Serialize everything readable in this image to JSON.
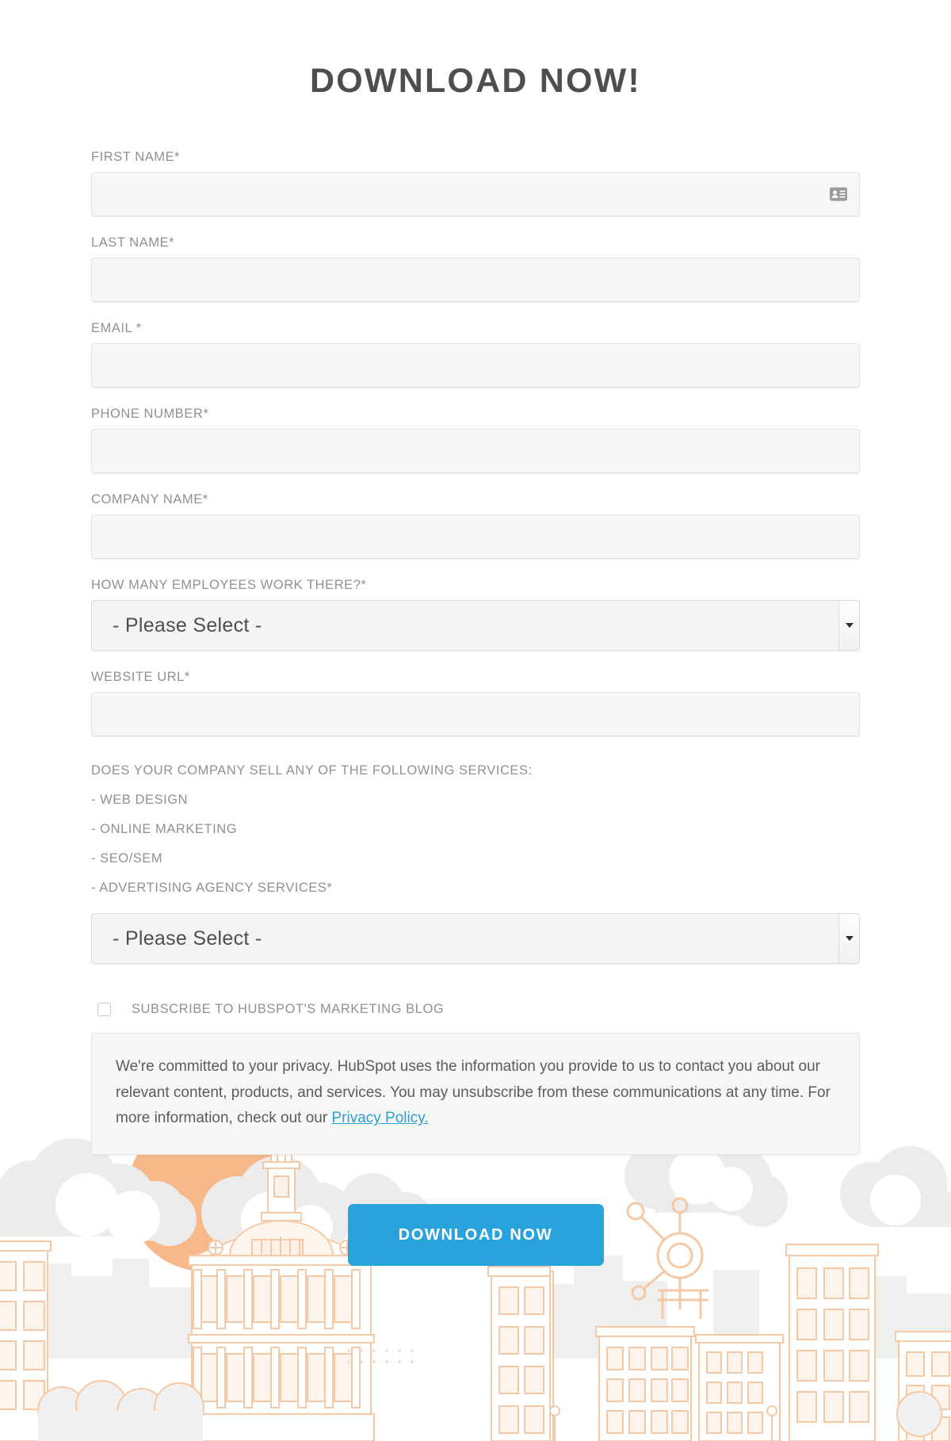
{
  "page": {
    "title": "DOWNLOAD NOW!",
    "background_color": "#ffffff",
    "title_color": "#4e4e4e"
  },
  "form": {
    "fields": [
      {
        "label": "FIRST NAME*",
        "value": "",
        "placeholder": "",
        "type": "text",
        "name": "first-name",
        "icon": "contact-card-icon"
      },
      {
        "label": "LAST NAME*",
        "value": "",
        "placeholder": "",
        "type": "text",
        "name": "last-name"
      },
      {
        "label": "EMAIL *",
        "value": "",
        "placeholder": "",
        "type": "email",
        "name": "email"
      },
      {
        "label": "PHONE NUMBER*",
        "value": "",
        "placeholder": "",
        "type": "tel",
        "name": "phone-number"
      },
      {
        "label": "COMPANY NAME*",
        "value": "",
        "placeholder": "",
        "type": "text",
        "name": "company-name"
      }
    ],
    "employees_select": {
      "label": "HOW MANY EMPLOYEES WORK THERE?*",
      "selected": "- Please Select -",
      "options": [
        "- Please Select -"
      ]
    },
    "website_field": {
      "label": "WEBSITE URL*",
      "value": "",
      "placeholder": "",
      "type": "url",
      "name": "website-url"
    },
    "services": {
      "heading": "DOES YOUR COMPANY SELL ANY OF THE FOLLOWING SERVICES:",
      "items": [
        "- WEB DESIGN",
        "- ONLINE MARKETING",
        "- SEO/SEM",
        "- ADVERTISING AGENCY SERVICES*"
      ]
    },
    "services_select": {
      "selected": "- Please Select -",
      "options": [
        "- Please Select -"
      ]
    },
    "subscribe": {
      "label": "SUBSCRIBE TO HUBSPOT'S MARKETING BLOG",
      "checked": false
    },
    "privacy": {
      "text_before_link": "We're committed to your privacy. HubSpot uses the information you provide to us to contact you about our relevant content, products, and services. You may unsubscribe from these communications at any time. For more information, check out our ",
      "link_text": "Privacy Policy.",
      "link_color": "#2b9fd8"
    },
    "submit": {
      "label": "DOWNLOAD NOW",
      "color": "#29a3dc",
      "text_color": "#ffffff"
    }
  },
  "illustration": {
    "description": "city-skyline-line-art",
    "sun_color": "#f7b88a",
    "building_color": "#f6c9a6",
    "cloud_color": "#ececec",
    "logo": "hubspot-sprocket-icon"
  }
}
